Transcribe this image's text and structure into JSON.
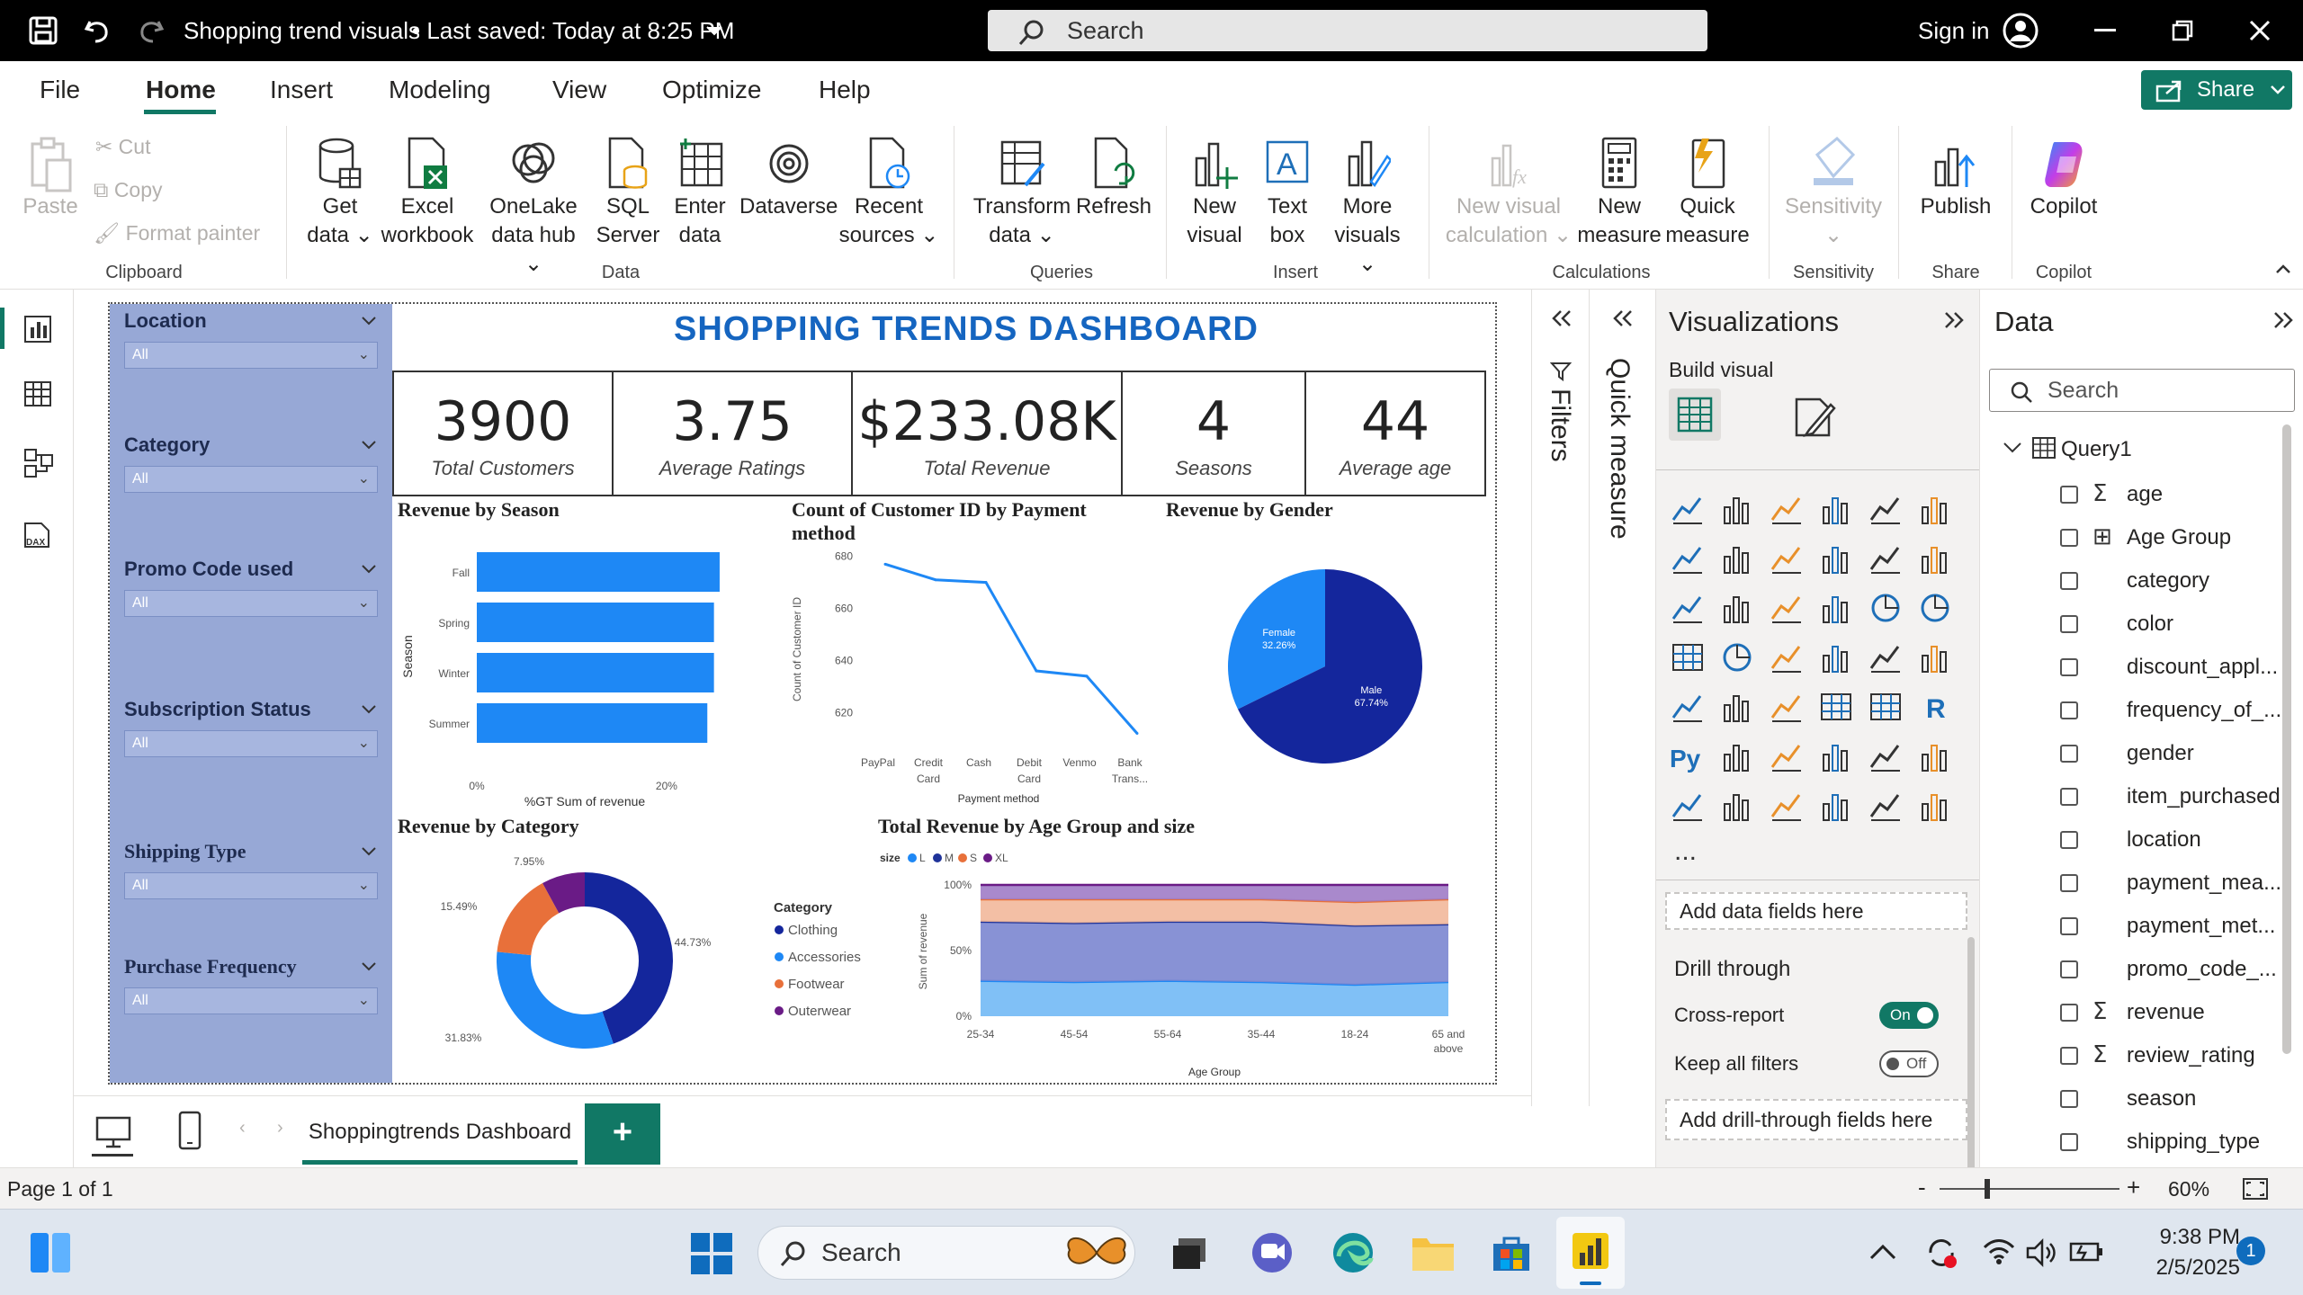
{
  "window": {
    "title": "Shopping trend visuals",
    "saved": "• Last saved: Today at 8:25 PM",
    "search_placeholder": "Search",
    "sign_in": "Sign in"
  },
  "menu": {
    "items": [
      "File",
      "Home",
      "Insert",
      "Modeling",
      "View",
      "Optimize",
      "Help"
    ],
    "active": "Home",
    "share": "Share"
  },
  "ribbon": {
    "clipboard": {
      "paste": "Paste",
      "cut": "Cut",
      "copy": "Copy",
      "format_painter": "Format painter",
      "group": "Clipboard"
    },
    "data": {
      "get_data": [
        "Get",
        "data"
      ],
      "excel": [
        "Excel",
        "workbook"
      ],
      "onelake": [
        "OneLake",
        "data hub"
      ],
      "sql": [
        "SQL",
        "Server"
      ],
      "enter": [
        "Enter",
        "data"
      ],
      "dataverse": [
        "Dataverse",
        ""
      ],
      "recent": [
        "Recent",
        "sources"
      ],
      "group": "Data"
    },
    "queries": {
      "transform": [
        "Transform",
        "data"
      ],
      "refresh": [
        "Refresh",
        ""
      ],
      "group": "Queries"
    },
    "insert": {
      "new_visual": [
        "New",
        "visual"
      ],
      "text_box": [
        "Text",
        "box"
      ],
      "more_visuals": [
        "More",
        "visuals"
      ],
      "group": "Insert"
    },
    "calculations": {
      "new_visual_calc": [
        "New visual",
        "calculation"
      ],
      "new_measure": [
        "New",
        "measure"
      ],
      "quick_measure": [
        "Quick",
        "measure"
      ],
      "group": "Calculations"
    },
    "sensitivity": {
      "label": "Sensitivity",
      "group": "Sensitivity"
    },
    "share": {
      "publish": "Publish",
      "group": "Share"
    },
    "copilot": {
      "label": "Copilot",
      "group": "Copilot"
    }
  },
  "slicers": [
    {
      "title": "Location",
      "value": "All"
    },
    {
      "title": "Category",
      "value": "All"
    },
    {
      "title": "Promo Code used",
      "value": "All"
    },
    {
      "title": "Subscription Status",
      "value": "All"
    },
    {
      "title": "Shipping Type",
      "value": "All"
    },
    {
      "title": "Purchase Frequency",
      "value": "All"
    }
  ],
  "dashboard": {
    "title": "SHOPPING TRENDS DASHBOARD",
    "kpis": [
      {
        "value": "3900",
        "label": "Total Customers"
      },
      {
        "value": "3.75",
        "label": "Average Ratings"
      },
      {
        "value": "$233.08K",
        "label": "Total Revenue"
      },
      {
        "value": "4",
        "label": "Seasons"
      },
      {
        "value": "44",
        "label": "Average age"
      }
    ]
  },
  "chart_data": [
    {
      "type": "bar",
      "title": "Revenue by Season",
      "orientation": "horizontal",
      "categories": [
        "Fall",
        "Spring",
        "Winter",
        "Summer"
      ],
      "values": [
        25.6,
        25.0,
        25.0,
        24.3
      ],
      "xlabel": "%GT Sum of revenue",
      "ylabel": "Season",
      "xticks": [
        "0%",
        "20%"
      ],
      "color": "#1e88f5"
    },
    {
      "type": "line",
      "title": "Count of Customer ID by Payment method",
      "categories": [
        "PayPal",
        "Credit Card",
        "Cash",
        "Debit Card",
        "Venmo",
        "Bank Trans..."
      ],
      "values": [
        677,
        671,
        670,
        636,
        634,
        612
      ],
      "ylabel": "Count of Customer ID",
      "xlabel": "Payment method",
      "yticks": [
        620,
        640,
        660,
        680
      ],
      "ylim": [
        607,
        683
      ],
      "color": "#1e88f5"
    },
    {
      "type": "pie",
      "title": "Revenue by Gender",
      "labels": [
        "Female",
        "Male"
      ],
      "values": [
        32.26,
        67.74
      ],
      "value_labels": [
        "32.26%",
        "67.74%"
      ],
      "colors": [
        "#1e88f5",
        "#14269c"
      ]
    },
    {
      "type": "pie",
      "title": "Revenue by Category",
      "donut": true,
      "legend_title": "Category",
      "labels": [
        "Clothing",
        "Accessories",
        "Footwear",
        "Outerwear"
      ],
      "values": [
        44.73,
        31.83,
        15.49,
        7.95
      ],
      "value_labels": [
        "44.73%",
        "31.83%",
        "15.49%",
        "7.95%"
      ],
      "colors": [
        "#14269c",
        "#1e88f5",
        "#e8703a",
        "#6a1b86"
      ]
    },
    {
      "type": "area",
      "title": "Total Revenue by Age Group and size",
      "stacked_percent": true,
      "legend_title": "size",
      "categories": [
        "25-34",
        "45-54",
        "55-64",
        "35-44",
        "18-24",
        "65 and above"
      ],
      "series": [
        {
          "name": "L",
          "values": [
            27,
            26,
            27,
            26,
            24,
            26
          ],
          "color": "#72b9f5"
        },
        {
          "name": "M",
          "values": [
            45,
            45,
            45,
            46,
            45,
            44
          ],
          "color": "#7b86d0"
        },
        {
          "name": "S",
          "values": [
            17,
            18,
            17,
            17,
            18,
            19
          ],
          "color": "#f2b89b"
        },
        {
          "name": "XL",
          "values": [
            11,
            11,
            11,
            11,
            13,
            11
          ],
          "color": "#a07cc6"
        }
      ],
      "line_colors": [
        "#1e88f5",
        "#1f3399",
        "#e8703a",
        "#6a1b86"
      ],
      "yticks": [
        "0%",
        "50%",
        "100%"
      ],
      "ylabel": "Sum of revenue",
      "xlabel": "Age Group"
    }
  ],
  "panes": {
    "filters": "Filters",
    "quick_measure": "Quick measure",
    "visualizations": {
      "title": "Visualizations",
      "build": "Build visual",
      "add_fields": "Add data fields here",
      "drill": "Drill through",
      "cross_report": "Cross-report",
      "cross_report_state": "On",
      "keep_filters": "Keep all filters",
      "keep_filters_state": "Off",
      "add_drill": "Add drill-through fields here",
      "more": "..."
    },
    "data": {
      "title": "Data",
      "search_placeholder": "Search",
      "table": "Query1",
      "fields": [
        {
          "name": "age",
          "sigma": true
        },
        {
          "name": "Age Group",
          "calc": true
        },
        {
          "name": "category"
        },
        {
          "name": "color"
        },
        {
          "name": "discount_appl..."
        },
        {
          "name": "frequency_of_..."
        },
        {
          "name": "gender"
        },
        {
          "name": "item_purchased"
        },
        {
          "name": "location"
        },
        {
          "name": "payment_mea..."
        },
        {
          "name": "payment_met..."
        },
        {
          "name": "promo_code_..."
        },
        {
          "name": "revenue",
          "sigma": true
        },
        {
          "name": "review_rating",
          "sigma": true
        },
        {
          "name": "season"
        },
        {
          "name": "shipping_type"
        }
      ]
    }
  },
  "pages": {
    "tab": "Shoppingtrends Dashboard",
    "add": "+"
  },
  "status": {
    "page": "Page 1 of 1",
    "zoom": "60%"
  },
  "taskbar": {
    "search": "Search",
    "time": "9:38 PM",
    "date": "2/5/2025",
    "badge": "1"
  }
}
